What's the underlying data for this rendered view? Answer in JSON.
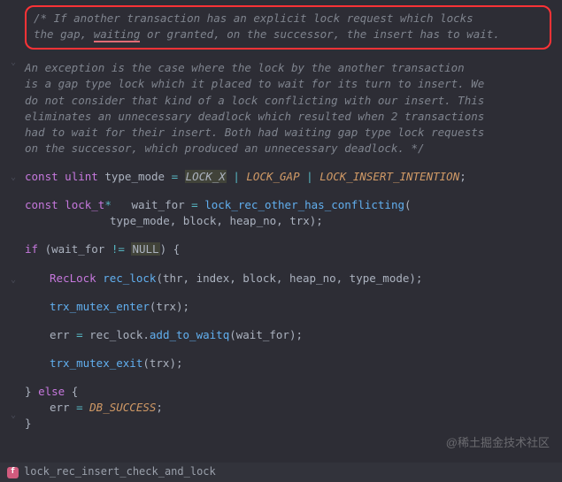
{
  "highlight_comment": {
    "l1": "/* If another transaction has an explicit lock request which locks",
    "l2a": "the gap, ",
    "l2_wait": "waiting",
    "l2b": " or granted, on the successor, the insert has to wait."
  },
  "comment2": {
    "l1": "An exception is the case where the lock by the another transaction",
    "l2": "is a gap type lock which it placed to wait for its turn to insert. We",
    "l3": "do not consider that kind of a lock conflicting with our insert. This",
    "l4": "eliminates an unnecessary deadlock which resulted when 2 transactions",
    "l5": "had to wait for their insert. Both had waiting gap type lock requests",
    "l6": "on the successor, which produced an unnecessary deadlock. */"
  },
  "tokens": {
    "const": "const",
    "ulint": "ulint",
    "type_mode": "type_mode",
    "eq": " = ",
    "LOCK_X": "LOCK_X",
    "pipe": " | ",
    "LOCK_GAP": "LOCK_GAP",
    "LOCK_INSERT_INTENTION": "LOCK_INSERT_INTENTION",
    "semi": ";",
    "lock_t": "lock_t",
    "star": "*",
    "wait_for": "wait_for",
    "lock_rec_other": "lock_rec_other_has_conflicting",
    "args1": "type_mode, block, heap_no, trx);",
    "if": "if",
    "neq": " != ",
    "NULL": "NULL",
    "brace_open_paren": ") {",
    "RecLock": "RecLock",
    "rec_lock": "rec_lock",
    "args2": "(thr, index, block, heap_no, type_mode);",
    "trx_mutex_enter": "trx_mutex_enter",
    "trx_arg": "(trx);",
    "err": "err",
    "add_to_waitq": "add_to_waitq",
    "args3": "(wait_for);",
    "trx_mutex_exit": "trx_mutex_exit",
    "else": "else",
    "close_else": "} ",
    "open_brace": " {",
    "DB_SUCCESS": "DB_SUCCESS",
    "close_brace": "}",
    "dot": "."
  },
  "status": {
    "badge": "f",
    "fn_name": "lock_rec_insert_check_and_lock"
  },
  "watermark": "@稀土掘金技术社区"
}
